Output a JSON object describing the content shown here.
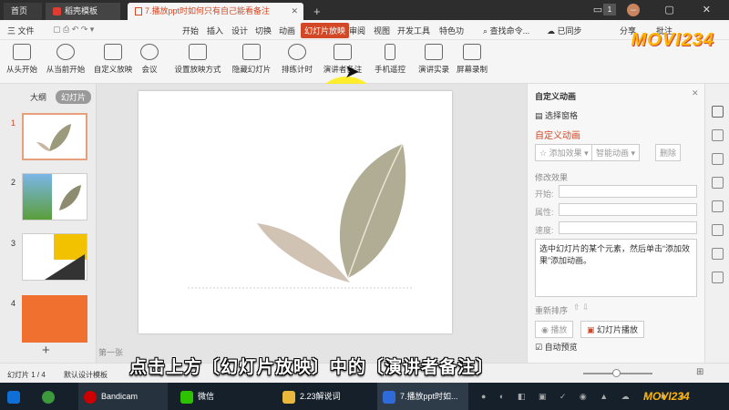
{
  "tabs": {
    "home": "首页",
    "template": "稻壳模板",
    "doc": "7.播放ppt时如何只有自己能看备注",
    "new": "+",
    "badge": "1"
  },
  "menu": {
    "file": "三 文件",
    "items": [
      "开始",
      "插入",
      "设计",
      "切换",
      "动画",
      "幻灯片放映",
      "审阅",
      "视图",
      "开发工具",
      "特色功"
    ],
    "search": "查找命令...",
    "sync": "已同步",
    "share": "分享",
    "annotate": "批注"
  },
  "ribbon": [
    {
      "label": "从头开始"
    },
    {
      "label": "从当前开始"
    },
    {
      "label": "自定义放映"
    },
    {
      "label": "会议"
    },
    {
      "label": "设置放映方式"
    },
    {
      "label": "隐藏幻灯片"
    },
    {
      "label": "排练计时"
    },
    {
      "label": "演讲者备注"
    },
    {
      "label": "手机遥控"
    },
    {
      "label": "演讲实录"
    },
    {
      "label": "屏幕录制"
    }
  ],
  "logo": "MOVI234",
  "left_panel": {
    "outline": "大纲",
    "slides": "幻灯片",
    "slide_numbers": [
      "1",
      "2",
      "3",
      "4"
    ],
    "add": "+"
  },
  "notes_placeholder": "第一张",
  "right_panel": {
    "title": "自定义动画",
    "select_pane": "选择窗格",
    "custom_anim": "自定义动画",
    "add_effect": "添加效果",
    "smart_anim": "智能动画",
    "delete": "删除",
    "modify": "修改效果",
    "start": "开始:",
    "property": "属性:",
    "speed": "速度:",
    "hint": "选中幻灯片的某个元素，然后单击“添加效果”添加动画。",
    "reorder": "重新排序",
    "play": "播放",
    "slideshow": "幻灯片播放",
    "autopreview": "自动预览"
  },
  "status": {
    "slide_count": "幻灯片 1 / 4",
    "theme": "默认设计模板"
  },
  "subtitle": "点击上方〔幻灯片放映〕中的〔演讲者备注〕",
  "taskbar": {
    "bandicam": "Bandicam",
    "wechat": "微信",
    "folder": "2.23解说词",
    "wps": "7.播放ppt时如...",
    "tray_logo": "MOVI234"
  },
  "colors": {
    "accent": "#d24726",
    "highlight": "#ffeb00",
    "taskbar": "#15202b"
  }
}
